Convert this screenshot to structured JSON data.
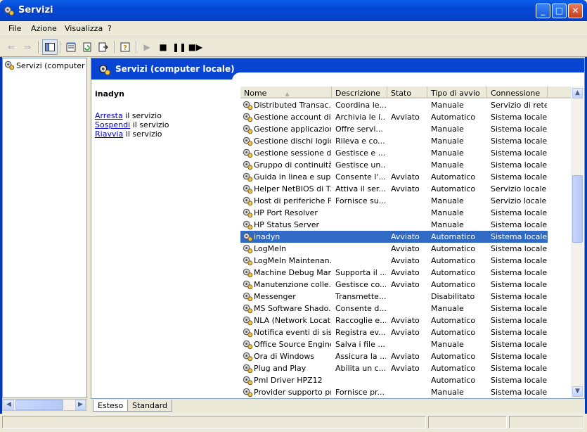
{
  "window": {
    "title": "Servizi"
  },
  "menu": [
    "File",
    "Azione",
    "Visualizza",
    "?"
  ],
  "tree": {
    "root_label": "Servizi (computer loc"
  },
  "banner": {
    "title": "Servizi (computer locale)"
  },
  "extended": {
    "service_name": "inadyn",
    "actions": [
      {
        "link": "Arresta",
        "text": " il servizio"
      },
      {
        "link": "Sospendi",
        "text": " il servizio"
      },
      {
        "link": "Riavvia",
        "text": " il servizio"
      }
    ]
  },
  "columns": [
    "Nome",
    "Descrizione",
    "Stato",
    "Tipo di avvio",
    "Connessione"
  ],
  "services": [
    {
      "name": "Distributed Transac...",
      "desc": "Coordina le...",
      "state": "",
      "startup": "Manuale",
      "logon": "Servizio di rete"
    },
    {
      "name": "Gestione account di...",
      "desc": "Archivia le i...",
      "state": "Avviato",
      "startup": "Automatico",
      "logon": "Sistema locale"
    },
    {
      "name": "Gestione applicazione",
      "desc": "Offre servi...",
      "state": "",
      "startup": "Manuale",
      "logon": "Sistema locale"
    },
    {
      "name": "Gestione dischi logici",
      "desc": "Rileva e co...",
      "state": "",
      "startup": "Manuale",
      "logon": "Sistema locale"
    },
    {
      "name": "Gestione sessione d...",
      "desc": "Gestisce e ...",
      "state": "",
      "startup": "Manuale",
      "logon": "Sistema locale"
    },
    {
      "name": "Gruppo di continuità",
      "desc": "Gestisce un...",
      "state": "",
      "startup": "Manuale",
      "logon": "Sistema locale"
    },
    {
      "name": "Guida in linea e sup...",
      "desc": "Consente l'...",
      "state": "Avviato",
      "startup": "Automatico",
      "logon": "Sistema locale"
    },
    {
      "name": "Helper NetBIOS di T...",
      "desc": "Attiva il ser...",
      "state": "Avviato",
      "startup": "Automatico",
      "logon": "Servizio locale"
    },
    {
      "name": "Host di periferiche P...",
      "desc": "Fornisce su...",
      "state": "",
      "startup": "Manuale",
      "logon": "Servizio locale"
    },
    {
      "name": "HP Port Resolver",
      "desc": "",
      "state": "",
      "startup": "Manuale",
      "logon": "Sistema locale"
    },
    {
      "name": "HP Status Server",
      "desc": "",
      "state": "",
      "startup": "Manuale",
      "logon": "Sistema locale"
    },
    {
      "name": "inadyn",
      "desc": "",
      "state": "Avviato",
      "startup": "Automatico",
      "logon": "Sistema locale",
      "selected": true
    },
    {
      "name": "LogMeIn",
      "desc": "",
      "state": "Avviato",
      "startup": "Automatico",
      "logon": "Sistema locale"
    },
    {
      "name": "LogMeIn Maintenan...",
      "desc": "",
      "state": "Avviato",
      "startup": "Automatico",
      "logon": "Sistema locale"
    },
    {
      "name": "Machine Debug Man...",
      "desc": "Supporta il ...",
      "state": "Avviato",
      "startup": "Automatico",
      "logon": "Sistema locale"
    },
    {
      "name": "Manutenzione colle...",
      "desc": "Gestisce co...",
      "state": "Avviato",
      "startup": "Automatico",
      "logon": "Sistema locale"
    },
    {
      "name": "Messenger",
      "desc": "Transmette...",
      "state": "",
      "startup": "Disabilitato",
      "logon": "Sistema locale"
    },
    {
      "name": "MS Software Shado...",
      "desc": "Consente d...",
      "state": "",
      "startup": "Manuale",
      "logon": "Sistema locale"
    },
    {
      "name": "NLA (Network Locat...",
      "desc": "Raccoglie e...",
      "state": "Avviato",
      "startup": "Automatico",
      "logon": "Sistema locale"
    },
    {
      "name": "Notifica eventi di sis...",
      "desc": "Registra ev...",
      "state": "Avviato",
      "startup": "Automatico",
      "logon": "Sistema locale"
    },
    {
      "name": "Office Source Engine",
      "desc": "Salva i file ...",
      "state": "",
      "startup": "Manuale",
      "logon": "Sistema locale"
    },
    {
      "name": "Ora di Windows",
      "desc": "Assicura la ...",
      "state": "Avviato",
      "startup": "Automatico",
      "logon": "Sistema locale"
    },
    {
      "name": "Plug and Play",
      "desc": "Abilita un c...",
      "state": "Avviato",
      "startup": "Automatico",
      "logon": "Sistema locale"
    },
    {
      "name": "Pml Driver HPZ12",
      "desc": "",
      "state": "",
      "startup": "Automatico",
      "logon": "Sistema locale"
    },
    {
      "name": "Provider supporto pr...",
      "desc": "Fornisce pr...",
      "state": "",
      "startup": "Manuale",
      "logon": "Sistema locale"
    }
  ],
  "tabs": [
    "Esteso",
    "Standard"
  ],
  "colors": {
    "titlebar": "#0348d5",
    "banner": "#0845d2",
    "selection": "#316ac5"
  }
}
